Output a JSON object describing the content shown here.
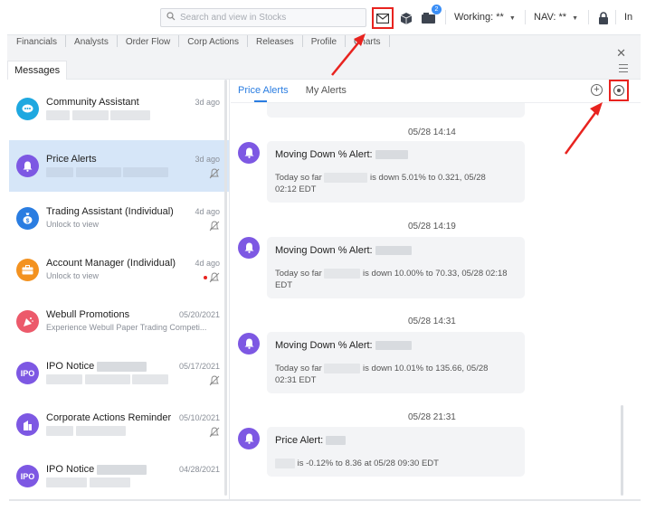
{
  "topbar": {
    "search_placeholder": "Search and view in Stocks",
    "message_badge": "2",
    "working_label": "Working: **",
    "nav_label": "NAV: **",
    "cut_label": "In"
  },
  "tabs": [
    "Financials",
    "Analysts",
    "Order Flow",
    "Corp Actions",
    "Releases",
    "Profile",
    "Charts"
  ],
  "panel": {
    "title": "Messages"
  },
  "messages": [
    {
      "name": "Community Assistant",
      "date": "3d ago",
      "sub": "",
      "icon": "chat-icon",
      "color": "#1ea8e0",
      "muted": false
    },
    {
      "name": "Price Alerts",
      "date": "3d ago",
      "sub": "",
      "icon": "bell-icon",
      "color": "#7d58e3",
      "muted": true,
      "selected": true
    },
    {
      "name": "Trading Assistant (Individual)",
      "date": "4d ago",
      "sub": "Unlock to view",
      "icon": "money-bag-icon",
      "color": "#2a7de1",
      "muted": true
    },
    {
      "name": "Account Manager (Individual)",
      "date": "4d ago",
      "sub": "Unlock to view",
      "icon": "briefcase-icon",
      "color": "#f39220",
      "muted": true,
      "unread": true
    },
    {
      "name": "Webull Promotions",
      "date": "05/20/2021",
      "sub": "Experience Webull Paper Trading Competi...",
      "icon": "party-icon",
      "color": "#ec5a6b",
      "muted": false
    },
    {
      "name": "IPO Notice",
      "date": "05/17/2021",
      "sub": "",
      "icon": "ipo-icon",
      "color": "#7d58e3",
      "avatar_text": "IPO",
      "muted": true
    },
    {
      "name": "Corporate Actions Reminder",
      "date": "05/10/2021",
      "sub": "",
      "icon": "building-icon",
      "color": "#7d58e3",
      "muted": true
    },
    {
      "name": "IPO Notice",
      "date": "04/28/2021",
      "sub": "",
      "icon": "ipo-icon",
      "color": "#7d58e3",
      "avatar_text": "IPO",
      "muted": false
    }
  ],
  "detail": {
    "tabs": [
      "Price Alerts",
      "My Alerts"
    ],
    "alerts": [
      {
        "time": "05/28 14:14",
        "title": "Moving Down % Alert:",
        "prefix": "Today so far",
        "body": "is down 5.01% to 0.321, 05/28",
        "body2": "02:12 EDT"
      },
      {
        "time": "05/28 14:19",
        "title": "Moving Down % Alert:",
        "prefix": "Today so far",
        "body": "is down 10.00% to 70.33, 05/28 02:18",
        "body2": "EDT"
      },
      {
        "time": "05/28 14:31",
        "title": "Moving Down % Alert:",
        "prefix": "Today so far",
        "body": "is down 10.01% to 135.66, 05/28",
        "body2": "02:31 EDT"
      },
      {
        "time": "05/28 21:31",
        "title": "Price Alert:",
        "prefix": "",
        "body": "is -0.12% to 8.36 at 05/28 09:30 EDT",
        "body2": ""
      }
    ]
  }
}
